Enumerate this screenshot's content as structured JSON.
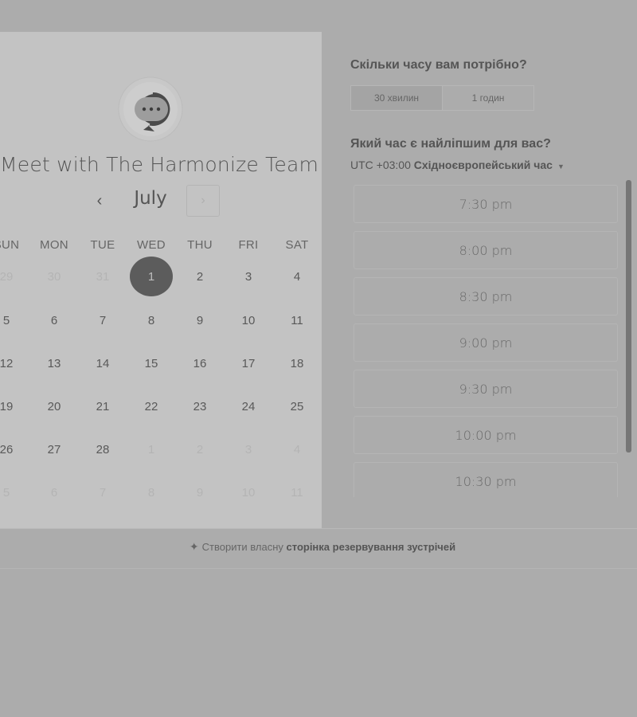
{
  "meeting": {
    "title": "Meet with The Harmonize Team"
  },
  "calendar": {
    "month": "July",
    "prev_icon": "chevron-left-icon",
    "next_icon": "chevron-right-icon",
    "weekdays": [
      "SUN",
      "MON",
      "TUE",
      "WED",
      "THU",
      "FRI",
      "SAT"
    ],
    "weeks": [
      [
        {
          "d": "29",
          "m": true
        },
        {
          "d": "30",
          "m": true
        },
        {
          "d": "31",
          "m": true
        },
        {
          "d": "1",
          "sel": true
        },
        {
          "d": "2"
        },
        {
          "d": "3"
        },
        {
          "d": "4"
        }
      ],
      [
        {
          "d": "5"
        },
        {
          "d": "6"
        },
        {
          "d": "7"
        },
        {
          "d": "8"
        },
        {
          "d": "9"
        },
        {
          "d": "10"
        },
        {
          "d": "11"
        }
      ],
      [
        {
          "d": "12"
        },
        {
          "d": "13"
        },
        {
          "d": "14"
        },
        {
          "d": "15"
        },
        {
          "d": "16"
        },
        {
          "d": "17"
        },
        {
          "d": "18"
        }
      ],
      [
        {
          "d": "19"
        },
        {
          "d": "20"
        },
        {
          "d": "21"
        },
        {
          "d": "22"
        },
        {
          "d": "23"
        },
        {
          "d": "24"
        },
        {
          "d": "25"
        }
      ],
      [
        {
          "d": "26"
        },
        {
          "d": "27"
        },
        {
          "d": "28"
        },
        {
          "d": "1",
          "m": true
        },
        {
          "d": "2",
          "m": true
        },
        {
          "d": "3",
          "m": true
        },
        {
          "d": "4",
          "m": true
        }
      ],
      [
        {
          "d": "5",
          "m": true
        },
        {
          "d": "6",
          "m": true
        },
        {
          "d": "7",
          "m": true
        },
        {
          "d": "8",
          "m": true
        },
        {
          "d": "9",
          "m": true
        },
        {
          "d": "10",
          "m": true
        },
        {
          "d": "11",
          "m": true
        }
      ]
    ]
  },
  "duration": {
    "question": "Скільки часу вам потрібно?",
    "options": [
      "30 хвилин",
      "1 годин"
    ],
    "selected": "30 хвилин"
  },
  "time": {
    "question": "Який час є найліпшим для вас?",
    "tz_offset": "UTC +03:00",
    "tz_name": "Східноєвропейський час",
    "slots": [
      "7:30 pm",
      "8:00 pm",
      "8:30 pm",
      "9:00 pm",
      "9:30 pm",
      "10:00 pm",
      "10:30 pm"
    ]
  },
  "footer": {
    "icon": "hubspot-sprocket-icon",
    "text_plain": "Створити власну",
    "text_bold": "сторінка резервування зустрічей"
  }
}
